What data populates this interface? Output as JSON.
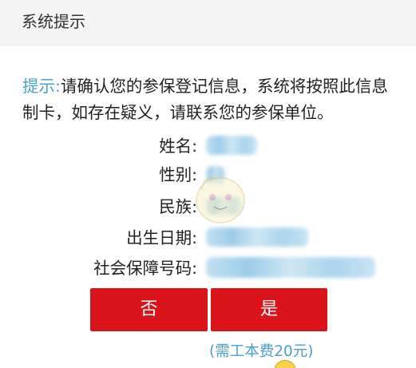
{
  "title": "系统提示",
  "message": {
    "hint_label": "提示:",
    "body": "请确认您的参保登记信息，系统将按照此信息制卡，如存在疑义，请联系您的参保单位。"
  },
  "fields": [
    {
      "label": "姓名:"
    },
    {
      "label": "性别:"
    },
    {
      "label": "民族:"
    },
    {
      "label": "出生日期:"
    },
    {
      "label": "社会保障号码:"
    }
  ],
  "buttons": {
    "no_label": "否",
    "yes_label": "是"
  },
  "fee_note": "(需工本费20元)",
  "colors": {
    "accent_blue": "#4a9fcf",
    "button_red": "#d9141b",
    "title_bar_bg": "#f4f4f4"
  }
}
